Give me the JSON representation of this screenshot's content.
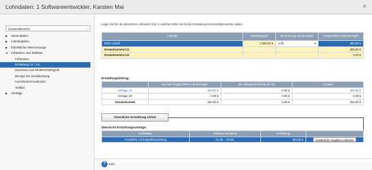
{
  "window": {
    "title": "Lohndaten: 1  Softwareentwickler, Karsten Mai",
    "close": "×"
  },
  "sidebar": {
    "select_value": "Gesamtübersicht",
    "items": [
      {
        "label": "Stammdaten",
        "arrow": "▶",
        "level": 0
      },
      {
        "label": "Lohnangaben",
        "arrow": "▶",
        "level": 0
      },
      {
        "label": "betriebliche Altersvorsorge",
        "arrow": "▶",
        "level": 0
      },
      {
        "label": "Fehlzeiten und Teilfelde",
        "arrow": "▼",
        "level": 0
      },
      {
        "label": "Fehlzeiten",
        "arrow": "",
        "level": 1
      },
      {
        "label": "Erstattung U1 / U2",
        "arrow": "",
        "level": 1,
        "active": true
      },
      {
        "label": "Zuschuss zum Mutterschaftsgeld",
        "arrow": "",
        "level": 1
      },
      {
        "label": "Bezüge bei Sozialleistung",
        "arrow": "",
        "level": 1
      },
      {
        "label": "Korrekturen/Ausdrucks",
        "arrow": "",
        "level": 1
      },
      {
        "label": "Teilfeld",
        "arrow": "",
        "level": 1
      },
      {
        "label": "Vorträge",
        "arrow": "▶",
        "level": 0
      }
    ]
  },
  "main": {
    "intro": "Legen Sie für die besuchten Lohnarten fest, in welcher Höhe sie für die Erstattung berücksichtigt werden sollen.",
    "table1": {
      "headers": [
        "Lohnart",
        "Arbeitsentgelt",
        "Berechnung auf die Basis",
        "Fortgezahltes Arbeitsentgelt"
      ],
      "rows": [
        {
          "label": "0002 Gehalt",
          "entgelt": "2.500,00 €",
          "basis": "1,00",
          "fortgezahlt": "360,00 €"
        },
        {
          "label": "Gesamtsumme U1",
          "entgelt": "",
          "basis": "",
          "fortgezahlt": "360,00 €"
        },
        {
          "label": "Gesamtsumme U2",
          "entgelt": "",
          "basis": "",
          "fortgezahlt": "0,00 €"
        }
      ]
    },
    "section2_title": "Erstattungsbetrag:",
    "table2": {
      "headers": [
        "",
        "aus dem fortgezahlten Arbeitsentgelt",
        "die Arbeitgeberanteils zur SV",
        "Gesamt"
      ],
      "rows": [
        {
          "label": "Umlage U1",
          "a": "252,00 €",
          "b": "0,00 €",
          "c": "252,00 €"
        },
        {
          "label": "Umlage U2",
          "a": "0,00 €",
          "b": "0,00 €",
          "c": "0,00 €"
        },
        {
          "label": "Gesamtsumme",
          "a": "252,00 €",
          "b": "0,00 €",
          "c": "252,00 €"
        }
      ]
    },
    "checklist_button": "Checkliste Erstattung U1/U2",
    "section3_title": "Übersicht Erstattungsanträge:",
    "table3": {
      "headers": [
        "Fehlzeiten",
        "Zeitraum im Monat",
        "Erstattung",
        ""
      ],
      "rows": [
        {
          "fehlzeit": "Krankheit, mit Entgeltfortzahlung",
          "zeitraum": "01.05. - 04.05.",
          "erstattung": "252,00 €",
          "action": "zusätzliche Angaben erfassen"
        }
      ]
    }
  },
  "footer": {
    "help_label": "Hilfe",
    "help_glyph": "?"
  },
  "colors": {
    "accent": "#2b6db5",
    "header": "#8d9fb4",
    "highlight_yellow": "#fff3c0"
  }
}
